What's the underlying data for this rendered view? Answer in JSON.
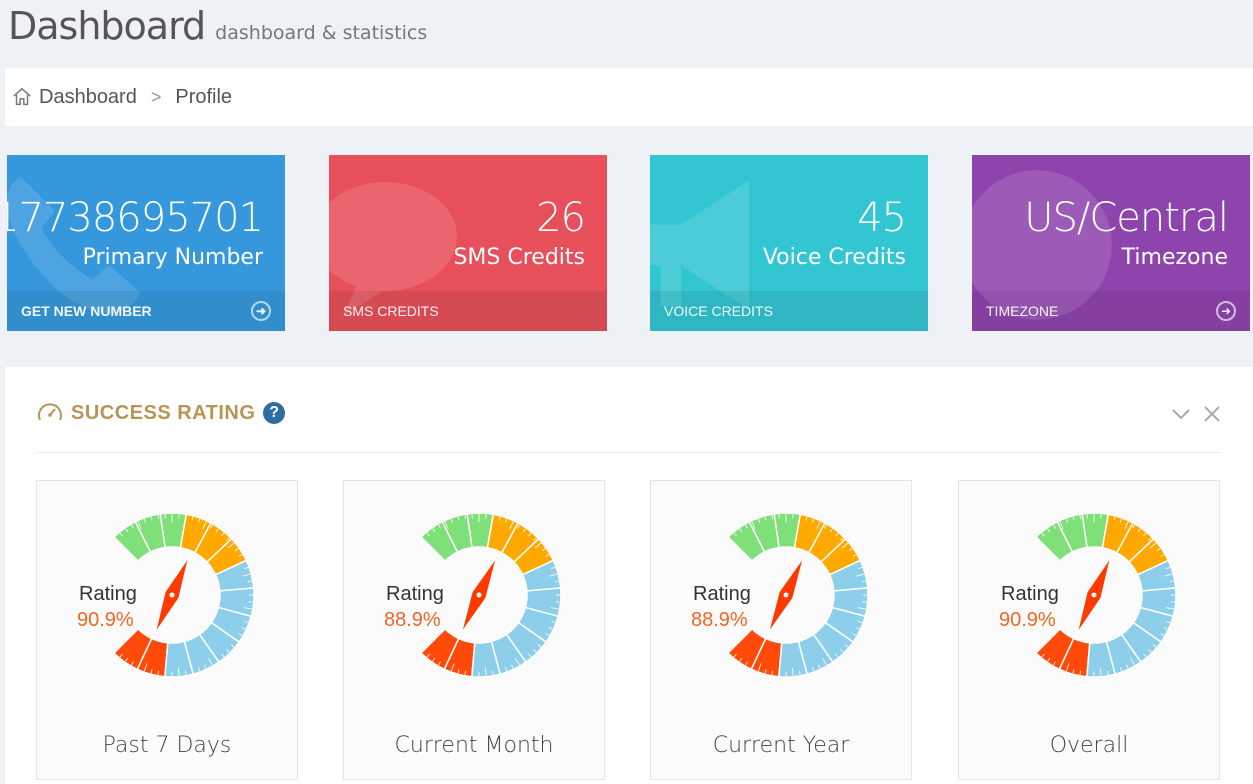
{
  "header": {
    "title": "Dashboard",
    "subtitle": "dashboard & statistics"
  },
  "breadcrumb": {
    "items": [
      "Dashboard",
      "Profile"
    ],
    "separator": ">"
  },
  "stats": [
    {
      "number": "17738695701",
      "desc": "Primary Number",
      "link": "GET NEW NUMBER",
      "color": "#3598dc",
      "icon": "phone-icon",
      "has_arrow": true
    },
    {
      "number": "26",
      "desc": "SMS Credits",
      "link": "SMS CREDITS",
      "color": "#e7505a",
      "icon": "chat-bubble-icon",
      "has_arrow": false
    },
    {
      "number": "45",
      "desc": "Voice Credits",
      "link": "VOICE CREDITS",
      "color": "#32c5d2",
      "icon": "megaphone-icon",
      "has_arrow": false
    },
    {
      "number": "US/Central",
      "desc": "Timezone",
      "link": "TIMEZONE",
      "color": "#8e44ad",
      "icon": "globe-icon",
      "has_arrow": true
    }
  ],
  "success_rating": {
    "title": "SUCCESS RATING",
    "help": "?",
    "gauges": [
      {
        "label": "Rating",
        "value": "90.9%",
        "period": "Past 7 Days",
        "needle_fraction": 0.909
      },
      {
        "label": "Rating",
        "value": "88.9%",
        "period": "Current Month",
        "needle_fraction": 0.889
      },
      {
        "label": "Rating",
        "value": "88.9%",
        "period": "Current Year",
        "needle_fraction": 0.889
      },
      {
        "label": "Rating",
        "value": "90.9%",
        "period": "Overall",
        "needle_fraction": 0.909
      }
    ]
  },
  "colors": {
    "gauge_green": "#7fe07a",
    "gauge_orange": "#ffa800",
    "gauge_blue": "#8dcfea",
    "gauge_red": "#ff4a0a",
    "needle": "#ff3a00"
  }
}
